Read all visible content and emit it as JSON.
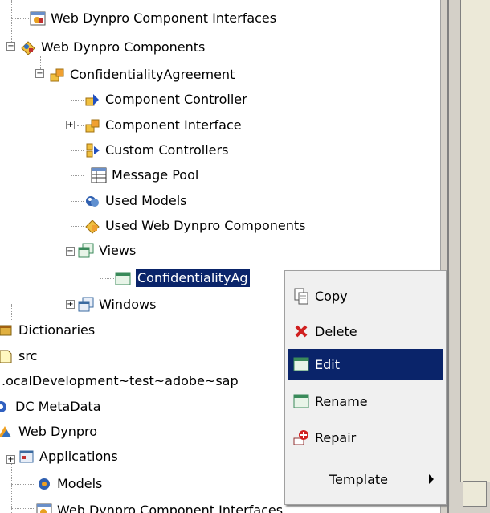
{
  "tree": {
    "items": [
      {
        "label": "Web Dynpro Component Interfaces",
        "icon": "component-interfaces-icon"
      },
      {
        "label": "Web Dynpro Components",
        "icon": "components-icon"
      },
      {
        "label": "ConfidentialityAgreement",
        "icon": "component-icon"
      },
      {
        "label": "Component Controller",
        "icon": "controller-icon"
      },
      {
        "label": "Component Interface",
        "icon": "component-interface-icon"
      },
      {
        "label": "Custom Controllers",
        "icon": "custom-controllers-icon"
      },
      {
        "label": "Message Pool",
        "icon": "message-pool-icon"
      },
      {
        "label": "Used Models",
        "icon": "used-models-icon"
      },
      {
        "label": "Used Web Dynpro Components",
        "icon": "used-components-icon"
      },
      {
        "label": "Views",
        "icon": "views-icon"
      },
      {
        "label": "ConfidentialityAg",
        "icon": "view-icon"
      },
      {
        "label": "Windows",
        "icon": "windows-icon"
      },
      {
        "label": "Dictionaries",
        "icon": "dictionaries-icon"
      },
      {
        "label": "src",
        "icon": "folder-icon"
      },
      {
        "label": ".ocalDevelopment~test~adobe~sap",
        "icon": ""
      },
      {
        "label": "DC MetaData",
        "icon": "dc-metadata-icon"
      },
      {
        "label": "Web Dynpro",
        "icon": "web-dynpro-icon"
      },
      {
        "label": "Applications",
        "icon": "applications-icon"
      },
      {
        "label": "Models",
        "icon": "models-icon"
      },
      {
        "label": "Web Dynpro Component Interfaces",
        "icon": "component-interfaces-icon"
      }
    ]
  },
  "context_menu": {
    "items": [
      {
        "label": "Copy",
        "icon": "copy-icon"
      },
      {
        "label": "Delete",
        "icon": "delete-icon"
      },
      {
        "label": "Edit",
        "icon": "edit-icon",
        "active": true
      },
      {
        "label": "Rename",
        "icon": "rename-icon"
      },
      {
        "label": "Repair",
        "icon": "repair-icon"
      },
      {
        "label": "Template",
        "icon": "",
        "submenu": true
      }
    ]
  },
  "colors": {
    "selection": "#0a246a",
    "menu_bg": "#f0f0f0",
    "chrome": "#d4d0c8"
  }
}
